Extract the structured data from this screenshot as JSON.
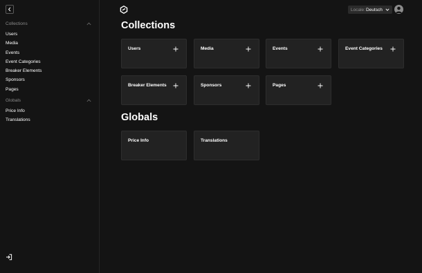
{
  "sidebar": {
    "collections_group_title": "Collections",
    "collections": [
      "Users",
      "Media",
      "Events",
      "Event Categories",
      "Breaker Elements",
      "Sponsors",
      "Pages"
    ],
    "globals_group_title": "Globals",
    "globals": [
      "Price Info",
      "Translations"
    ]
  },
  "header": {
    "locale_label": "Locale:",
    "locale_value": "Deutsch"
  },
  "main": {
    "collections_title": "Collections",
    "collection_cards": [
      "Users",
      "Media",
      "Events",
      "Event Categories",
      "Breaker Elements",
      "Sponsors",
      "Pages"
    ],
    "globals_title": "Globals",
    "global_cards": [
      "Price Info",
      "Translations"
    ]
  },
  "icons": {
    "collapse": "chevron-left-icon",
    "logo": "payload-logo-icon",
    "add": "plus-icon",
    "logout": "logout-icon",
    "group_toggle": "chevron-up-icon"
  },
  "colors": {
    "background": "#141414",
    "card": "#222222",
    "muted_text": "#8a8a8a",
    "text": "#ffffff"
  }
}
